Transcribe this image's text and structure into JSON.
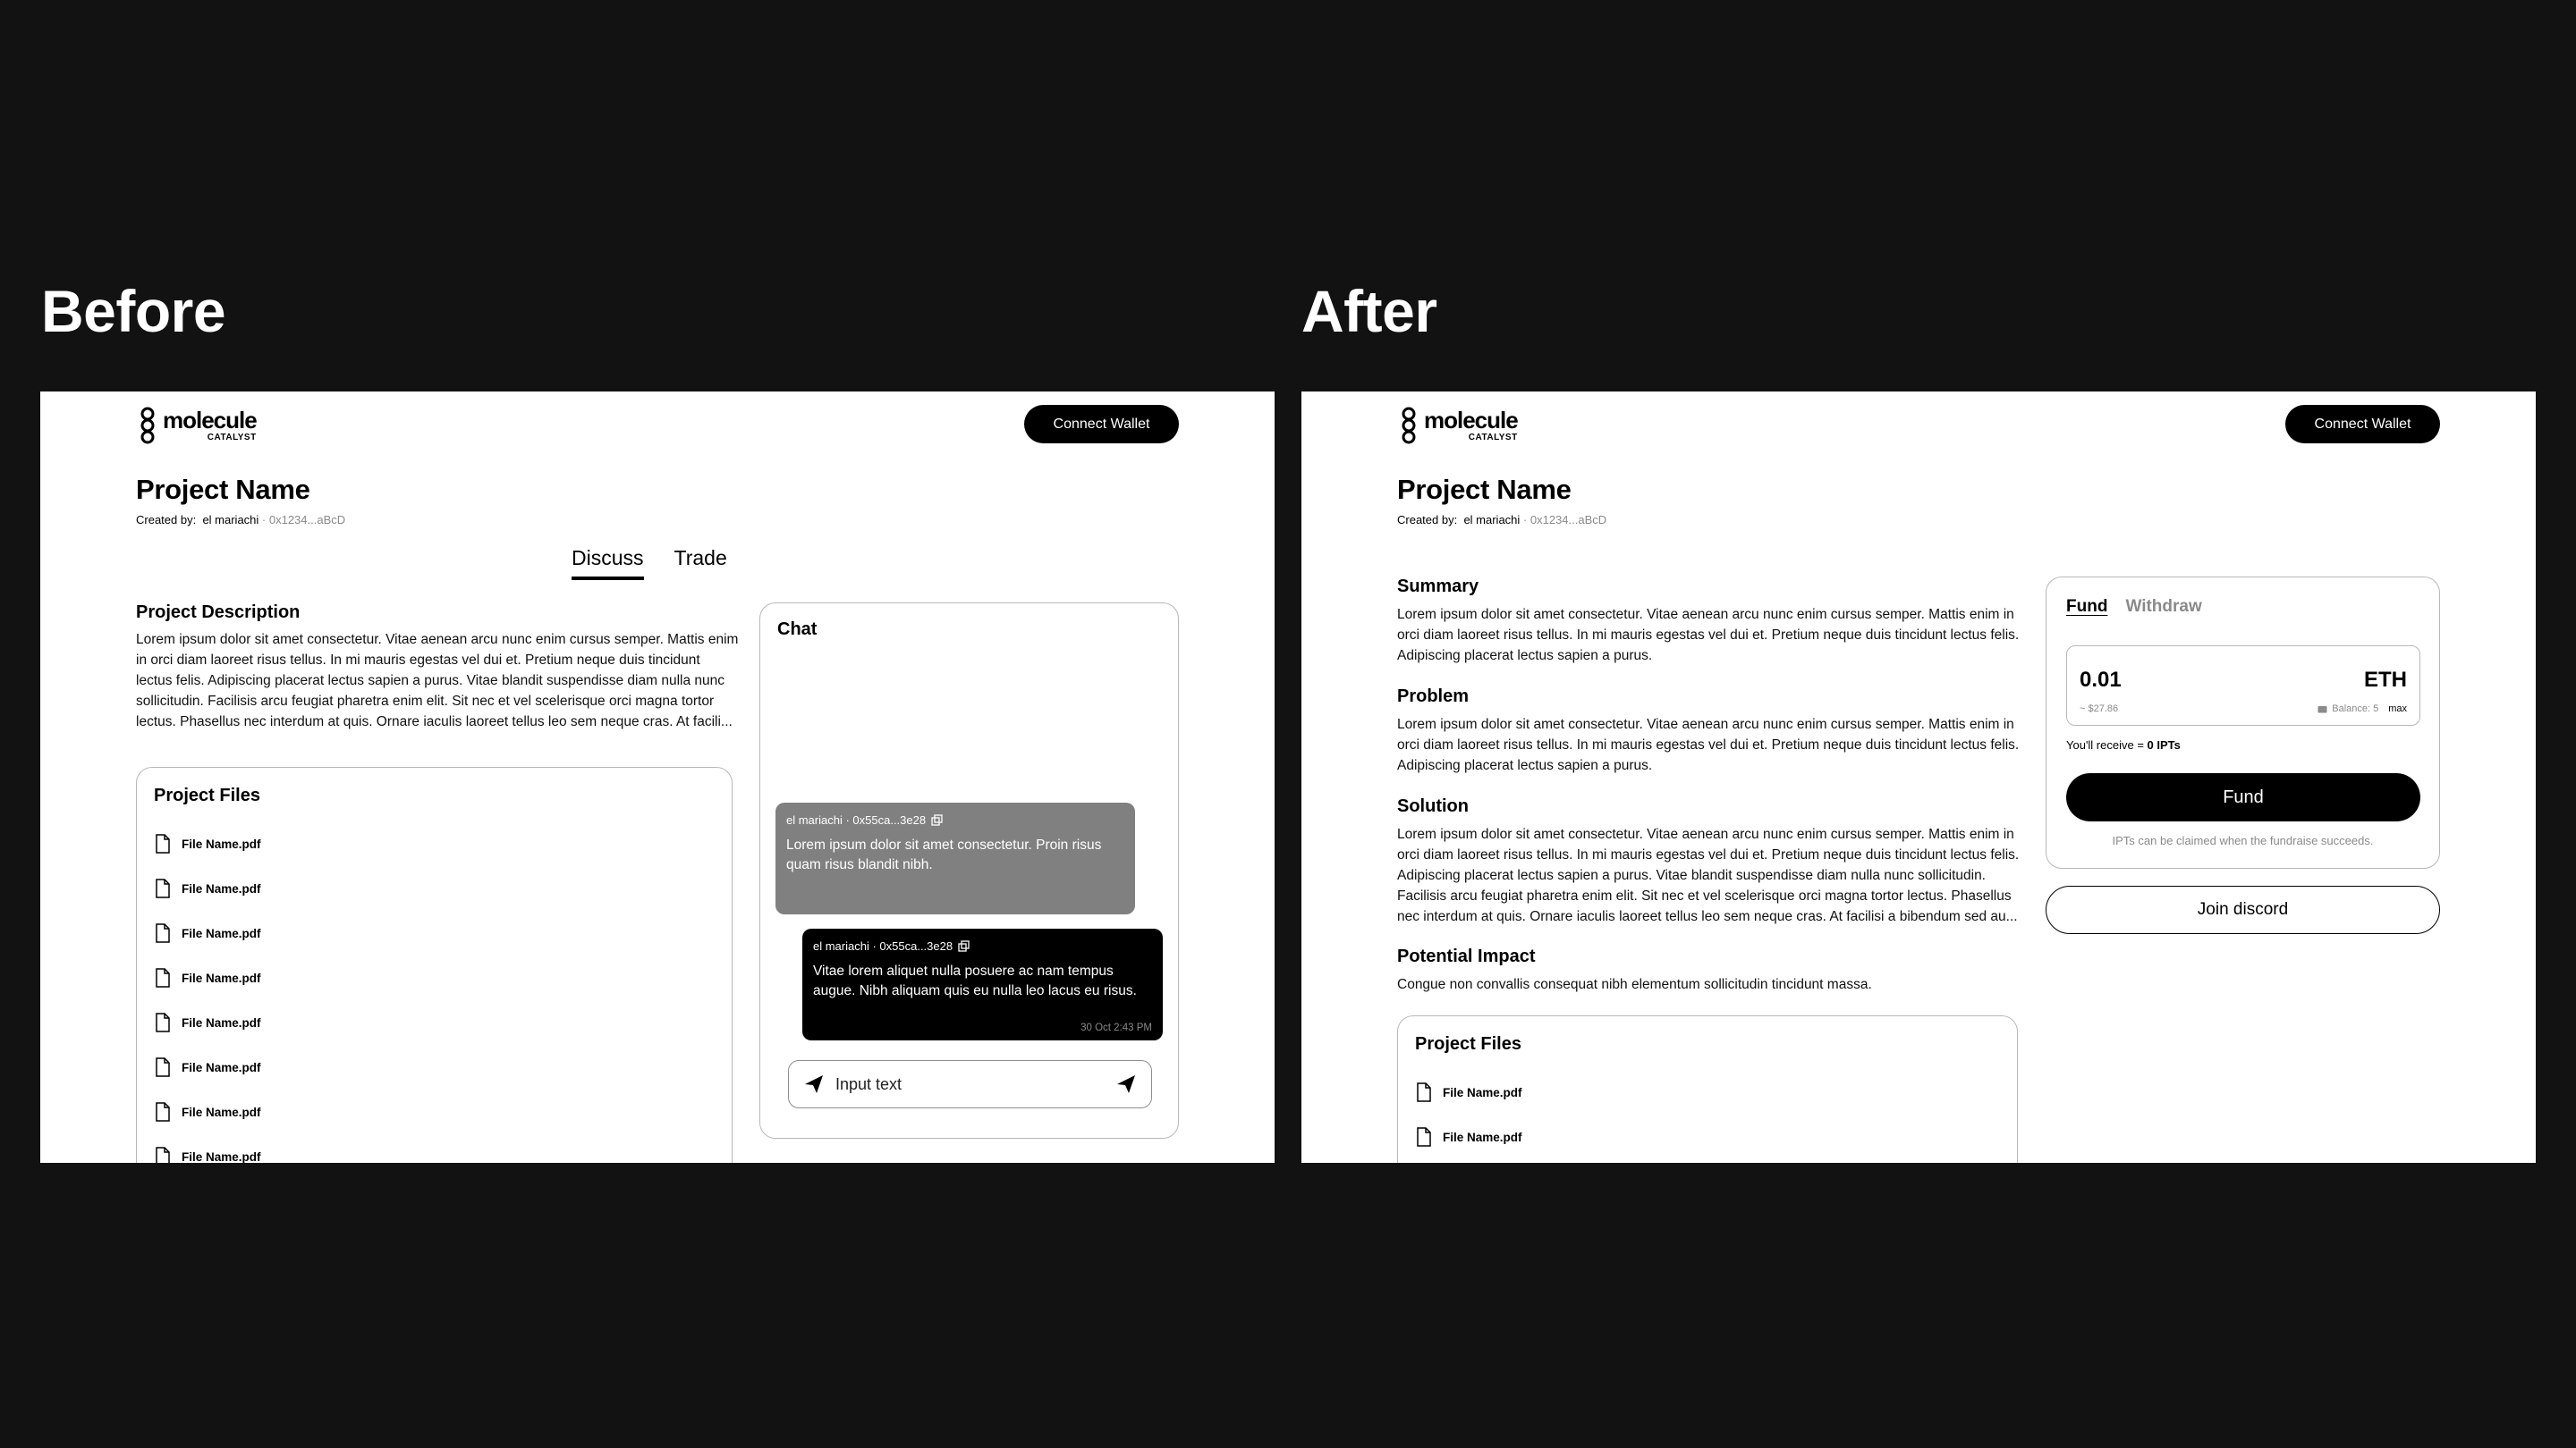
{
  "labels": {
    "before": "Before",
    "after": "After"
  },
  "header": {
    "logo_main": "molecule",
    "logo_sub": "CATALYST",
    "connect_wallet": "Connect Wallet"
  },
  "project": {
    "title": "Project Name",
    "created_by_label": "Created by:",
    "creator": "el mariachi",
    "creator_address": "· 0x1234...aBcD"
  },
  "before": {
    "tabs": [
      "Discuss",
      "Trade"
    ],
    "description_heading": "Project Description",
    "description_lines": [
      "Lorem ipsum dolor sit amet consectetur. Vitae aenean arcu nunc enim cursus semper. Mattis enim",
      "in orci diam laoreet risus tellus. In mi mauris egestas vel dui et. Pretium neque duis tincidunt",
      "lectus felis. Adipiscing placerat lectus sapien a purus. Vitae blandit suspendisse diam nulla nunc",
      "sollicitudin. Facilisis arcu feugiat pharetra enim elit. Sit nec et vel scelerisque orci magna tortor",
      "lectus. Phasellus nec interdum at quis. Ornare iaculis laoreet tellus leo sem neque cras. At facili..."
    ],
    "files_title": "Project Files",
    "files": [
      "File Name.pdf",
      "File Name.pdf",
      "File Name.pdf",
      "File Name.pdf",
      "File Name.pdf",
      "File Name.pdf",
      "File Name.pdf",
      "File Name.pdf"
    ],
    "chat": {
      "title": "Chat",
      "messages": [
        {
          "author": "el mariachi · 0x55ca...3e28",
          "text_lines": [
            "Lorem ipsum dolor sit amet consectetur. Proin risus",
            "quam risus blandit nibh."
          ],
          "time": ""
        },
        {
          "author": "el mariachi · 0x55ca...3e28",
          "text_lines": [
            "Vitae lorem aliquet nulla posuere ac nam tempus",
            "augue. Nibh aliquam quis eu nulla leo lacus eu risus."
          ],
          "time": "30 Oct 2:43 PM"
        }
      ],
      "input_placeholder": "Input text"
    }
  },
  "after": {
    "summary_heading": "Summary",
    "summary_lines": [
      "Lorem ipsum dolor sit amet consectetur. Vitae aenean arcu nunc enim cursus semper. Mattis enim in",
      "orci diam laoreet risus tellus. In mi mauris egestas vel dui et. Pretium neque duis tincidunt lectus felis.",
      "Adipiscing placerat lectus sapien a purus."
    ],
    "problem_heading": "Problem",
    "problem_lines": [
      "Lorem ipsum dolor sit amet consectetur. Vitae aenean arcu nunc enim cursus semper. Mattis enim in",
      "orci diam laoreet risus tellus. In mi mauris egestas vel dui et. Pretium neque duis tincidunt lectus felis.",
      "Adipiscing placerat lectus sapien a purus."
    ],
    "solution_heading": "Solution",
    "solution_lines": [
      "Lorem ipsum dolor sit amet consectetur. Vitae aenean arcu nunc enim cursus semper. Mattis enim in",
      "orci diam laoreet risus tellus. In mi mauris egestas vel dui et. Pretium neque duis tincidunt lectus felis.",
      "Adipiscing placerat lectus sapien a purus. Vitae blandit suspendisse diam nulla nunc sollicitudin.",
      "Facilisis arcu feugiat pharetra enim elit. Sit nec et vel scelerisque orci magna tortor lectus. Phasellus",
      "nec interdum at quis. Ornare iaculis laoreet tellus leo sem neque cras. At facilisi a bibendum sed au..."
    ],
    "impact_heading": "Potential Impact",
    "impact_lines": [
      "Congue non convallis consequat nibh elementum sollicitudin tincidunt massa."
    ],
    "files_title": "Project Files",
    "files": [
      "File Name.pdf",
      "File Name.pdf"
    ],
    "fund": {
      "tab_fund": "Fund",
      "tab_withdraw": "Withdraw",
      "amount": "0.01",
      "currency": "ETH",
      "usd": "~ $27.86",
      "balance": "Balance: 5",
      "max": "max",
      "receive_prefix": "You'll receive =",
      "receive_value": "0 IPTs",
      "fund_button": "Fund",
      "claim_note": "IPTs can be claimed when the fundraise succeeds.",
      "discord_button": "Join discord"
    }
  }
}
